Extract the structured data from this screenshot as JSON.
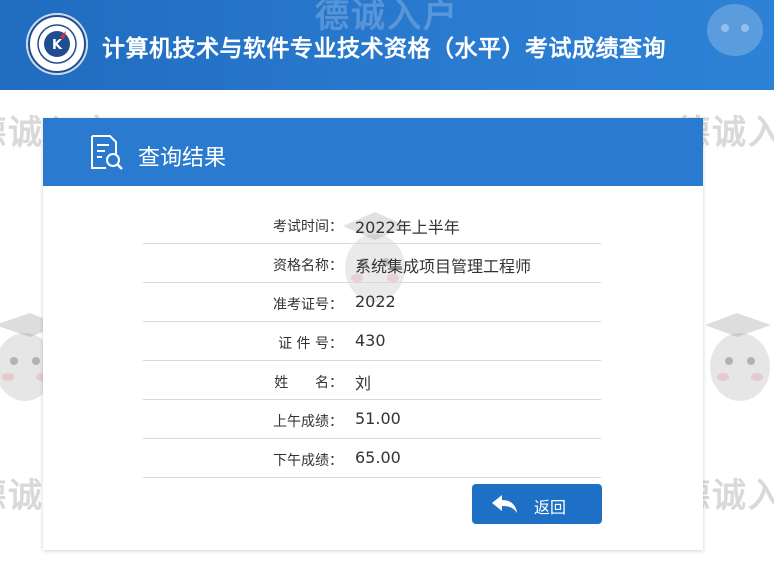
{
  "header": {
    "title": "计算机技术与软件专业技术资格（水平）考试成绩查询"
  },
  "card": {
    "title": "查询结果"
  },
  "results": [
    {
      "label": "考试时间：",
      "value": "2022年上半年"
    },
    {
      "label": "资格名称：",
      "value": "系统集成项目管理工程师"
    },
    {
      "label": "准考证号：",
      "value": "2022"
    },
    {
      "label": "证 件 号：",
      "value": "430"
    },
    {
      "label": "姓      名：",
      "value": "刘"
    },
    {
      "label": "上午成绩：",
      "value": "51.00"
    },
    {
      "label": "下午成绩：",
      "value": "65.00"
    }
  ],
  "back_button": {
    "label": "返回"
  },
  "watermark": {
    "text": "德诚入户"
  },
  "colors": {
    "header_bg": "#2a7bd0",
    "button_bg": "#1e70c6",
    "text": "#333333"
  },
  "icons": {
    "logo": "exam-logo-icon",
    "card": "document-search-icon",
    "back": "back-arrow-icon"
  }
}
